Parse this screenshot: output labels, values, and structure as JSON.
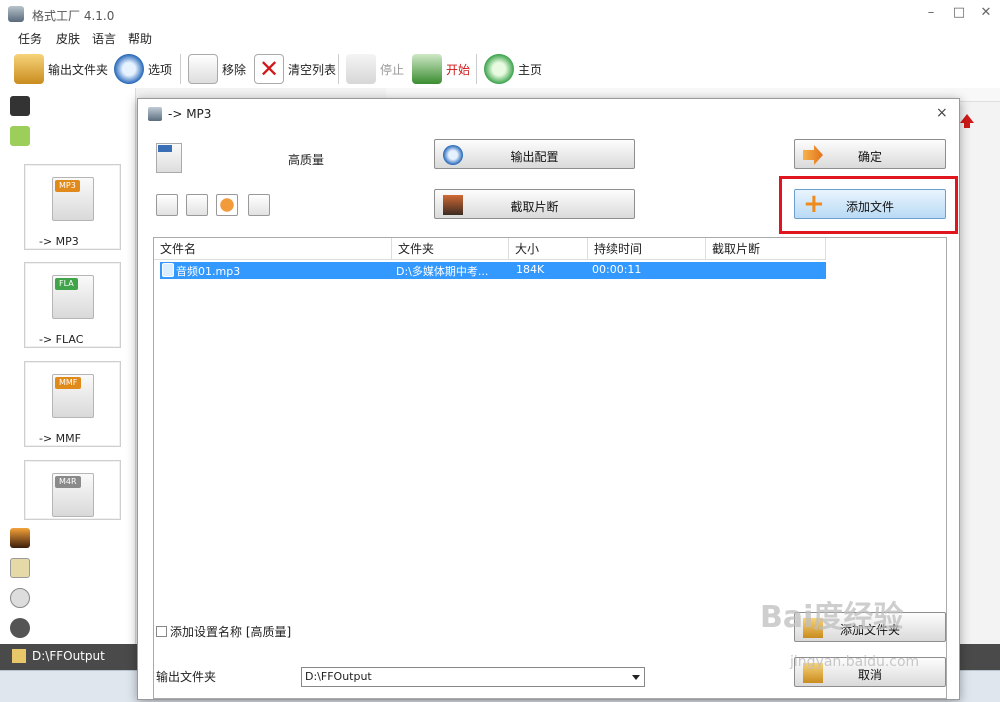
{
  "app": {
    "title": "格式工厂 4.1.0"
  },
  "window_controls": {
    "minimize": "–",
    "maximize": "□",
    "close": "✕"
  },
  "menu": [
    "任务",
    "皮肤",
    "语言",
    "帮助"
  ],
  "toolbar": {
    "output_folder": "输出文件夹",
    "options": "选项",
    "remove": "移除",
    "clear_list": "清空列表",
    "stop": "停止",
    "start": "开始",
    "home": "主页"
  },
  "formats": [
    {
      "label": "-> MP3",
      "tag": "MP3",
      "color": "#e08a1c"
    },
    {
      "label": "-> FLAC",
      "tag": "FLA",
      "color": "#41a34a"
    },
    {
      "label": "-> MMF",
      "tag": "MMF",
      "color": "#e08a1c"
    },
    {
      "label": "",
      "tag": "M4R",
      "color": "#8a8a8a"
    }
  ],
  "statusbar": {
    "path": "D:\\FFOutput"
  },
  "dialog": {
    "title": "-> MP3",
    "close": "×",
    "quality": "高质量",
    "output_config": "输出配置",
    "ok": "确定",
    "clip": "截取片断",
    "add_file": "添加文件",
    "add_folder": "添加文件夹",
    "cancel": "取消",
    "columns": [
      "文件名",
      "文件夹",
      "大小",
      "持续时间",
      "截取片断"
    ],
    "rows": [
      {
        "name": "音频01.mp3",
        "folder": "D:\\多媒体期中考...",
        "size": "184K",
        "duration": "00:00:11",
        "clip": ""
      }
    ],
    "add_setting_name": "添加设置名称 [高质量]",
    "output_folder_label": "输出文件夹",
    "output_folder_value": "D:\\FFOutput"
  },
  "watermark": {
    "logo": "Bai度经验",
    "url": "jingyan.baidu.com"
  },
  "colors": {
    "selection": "#3399ff",
    "highlight": "#e0161e",
    "accent_blue": "#b9daf5"
  }
}
